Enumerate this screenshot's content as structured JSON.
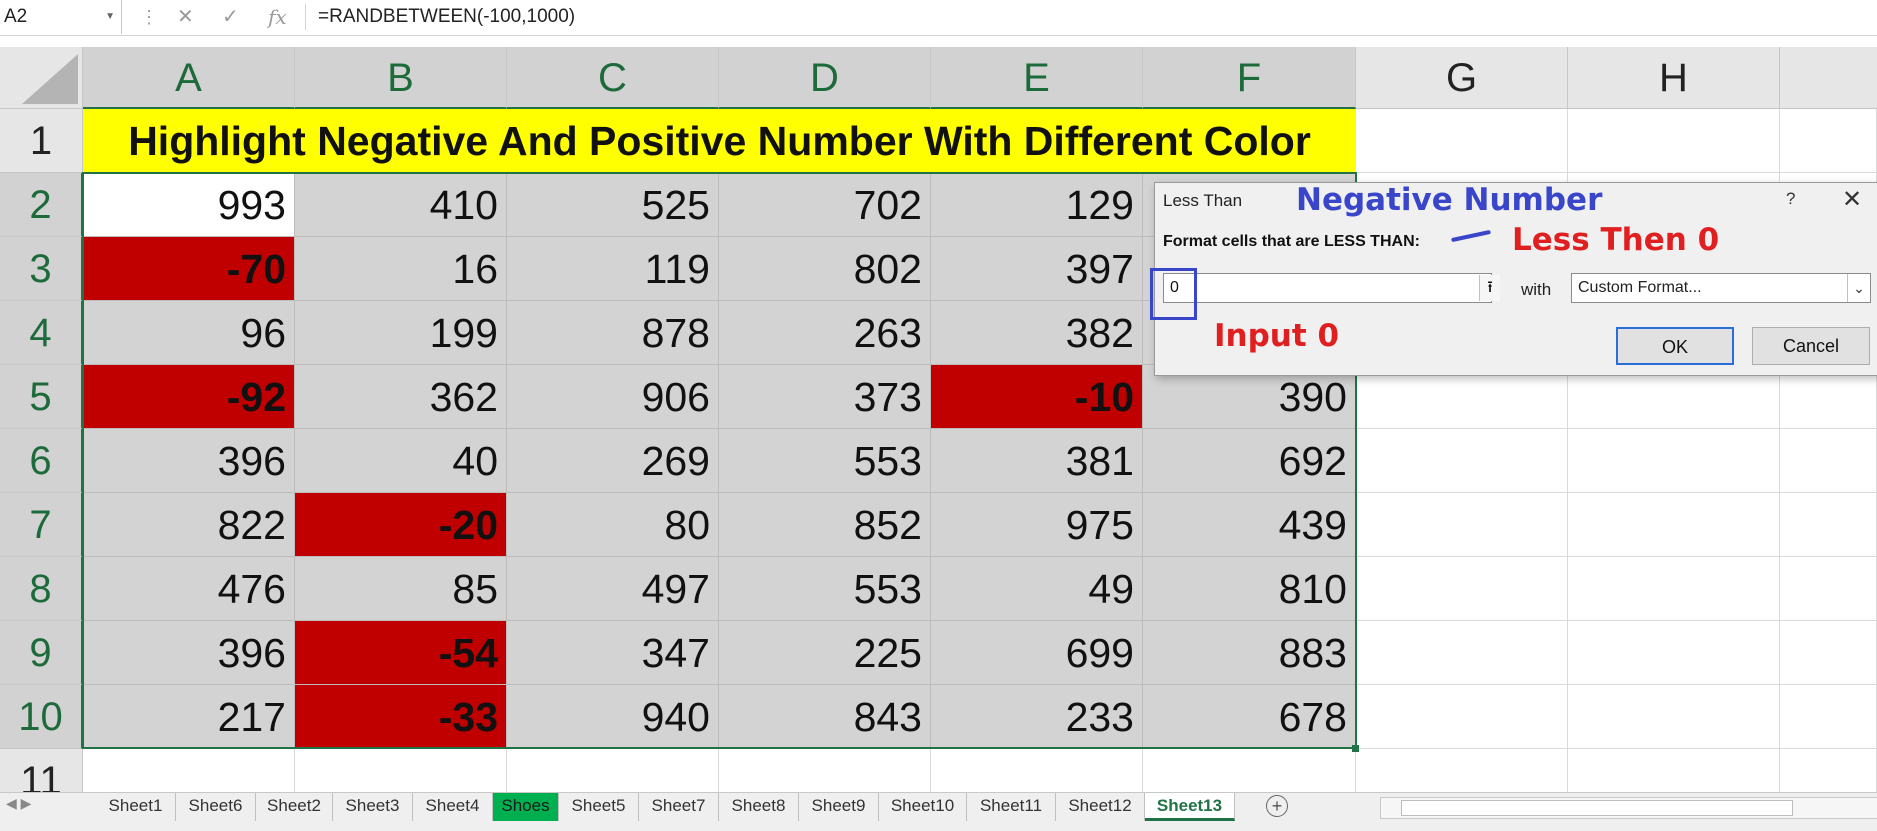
{
  "formula_bar": {
    "name_box": "A2",
    "formula": "=RANDBETWEEN(-100,1000)"
  },
  "columns": [
    "A",
    "B",
    "C",
    "D",
    "E",
    "F",
    "G",
    "H"
  ],
  "rows": [
    "1",
    "2",
    "3",
    "4",
    "5",
    "6",
    "7",
    "8",
    "9",
    "10",
    "11"
  ],
  "title": "Highlight Negative And Positive Number With Different Color",
  "table": [
    [
      "993",
      "410",
      "525",
      "702",
      "129",
      ""
    ],
    [
      "-70",
      "16",
      "119",
      "802",
      "397",
      ""
    ],
    [
      "96",
      "199",
      "878",
      "263",
      "382",
      ""
    ],
    [
      "-92",
      "362",
      "906",
      "373",
      "-10",
      "390"
    ],
    [
      "396",
      "40",
      "269",
      "553",
      "381",
      "692"
    ],
    [
      "822",
      "-20",
      "80",
      "852",
      "975",
      "439"
    ],
    [
      "476",
      "85",
      "497",
      "553",
      "49",
      "810"
    ],
    [
      "396",
      "-54",
      "347",
      "225",
      "699",
      "883"
    ],
    [
      "217",
      "-33",
      "940",
      "843",
      "233",
      "678"
    ]
  ],
  "dialog": {
    "title": "Less Than",
    "help": "?",
    "close": "✕",
    "label": "Format cells that are LESS THAN:",
    "input_value": "0",
    "with_label": "with",
    "format_value": "Custom Format...",
    "ok": "OK",
    "cancel": "Cancel"
  },
  "annotations": {
    "negative": "Negative Number",
    "less_then": "Less Then 0",
    "input": "Input 0"
  },
  "sheets": [
    "Sheet1",
    "Sheet6",
    "Sheet2",
    "Sheet3",
    "Sheet4",
    "Shoes",
    "Sheet5",
    "Sheet7",
    "Sheet8",
    "Sheet9",
    "Sheet10",
    "Sheet11",
    "Sheet12",
    "Sheet13"
  ],
  "colors": {
    "negative_fill": "#c00000",
    "title_fill": "#ffff00",
    "selection_fill": "#d3d3d3",
    "accent": "#217346",
    "shoes_tab": "#00b050"
  }
}
